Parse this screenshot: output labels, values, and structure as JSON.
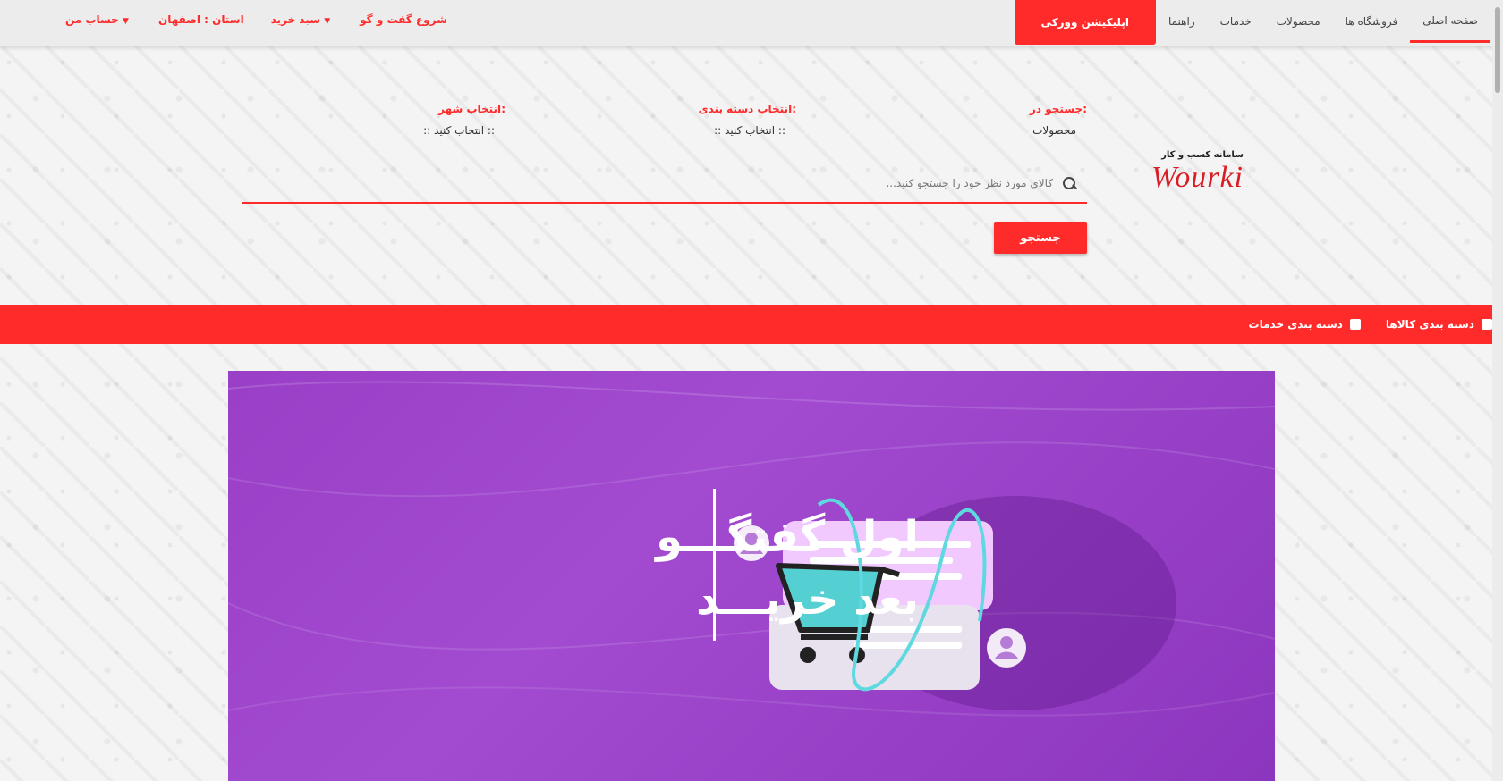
{
  "topnav": {
    "items": [
      "صفحه اصلی",
      "فروشگاه ها",
      "محصولات",
      "خدمات",
      "راهنما"
    ],
    "app_button": "اپلیکیشن وورکی",
    "left_links": {
      "chat": "شروع گفت و گو",
      "cart": "سبد خرید",
      "province": "استان : اصفهان",
      "account": "حساب من"
    }
  },
  "logo": {
    "subtitle": "سامانه کسب و کار",
    "name": "Wourki"
  },
  "search": {
    "search_in_label": "جستجو در:",
    "search_in_value": "محصولات",
    "category_label": "انتخاب دسته بندی:",
    "category_value": ":: انتخاب کنید ::",
    "city_label": "انتخاب شهر:",
    "city_value": ":: انتخاب کنید ::",
    "placeholder": "کالای مورد نظر خود را جستجو کنید...",
    "button": "جستجو"
  },
  "catbar": {
    "products": "دسته بندی کالاها",
    "services": "دسته بندی خدمات"
  },
  "banner": {
    "line1": "اول گفتگـــو",
    "line2": "بعد خریـــد"
  },
  "colors": {
    "accent": "#ff2b2b",
    "banner": "#9a3fc7"
  }
}
